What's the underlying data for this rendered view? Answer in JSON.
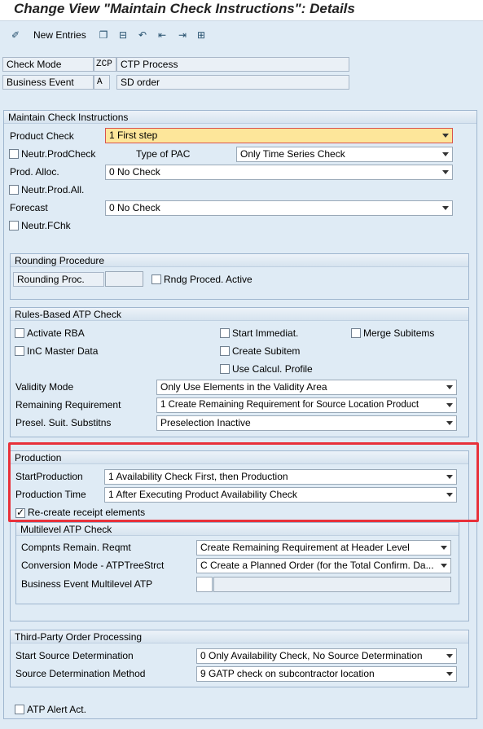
{
  "title": "Change View \"Maintain Check Instructions\": Details",
  "toolbar": {
    "new_entries": "New Entries"
  },
  "header": {
    "check_mode_label": "Check Mode",
    "check_mode_code": "ZCP",
    "check_mode_desc": "CTP Process",
    "business_event_label": "Business Event",
    "business_event_code": "A",
    "business_event_desc": "SD order"
  },
  "maintain": {
    "title": "Maintain Check Instructions",
    "product_check_label": "Product Check",
    "product_check_value": "1 First step",
    "neutr_prodcheck": "Neutr.ProdCheck",
    "type_of_pac_label": "Type of PAC",
    "type_of_pac_value": "Only Time Series Check",
    "prod_alloc_label": "Prod. Alloc.",
    "prod_alloc_value": "0 No Check",
    "neutr_prod_all": "Neutr.Prod.All.",
    "forecast_label": "Forecast",
    "forecast_value": "0 No Check",
    "neutr_fchk": "Neutr.FChk"
  },
  "rounding": {
    "title": "Rounding Procedure",
    "proc_label": "Rounding Proc.",
    "active_label": "Rndg Proced. Active"
  },
  "rba": {
    "title": "Rules-Based ATP Check",
    "activate_rba": "Activate RBA",
    "start_immediat": "Start Immediat.",
    "merge_subitems": "Merge Subitems",
    "inc_master": "InC Master Data",
    "create_subitem": "Create Subitem",
    "use_calcul": "Use Calcul. Profile",
    "validity_label": "Validity Mode",
    "validity_value": "Only Use Elements in the Validity Area",
    "remaining_label": "Remaining Requirement",
    "remaining_value": "1 Create Remaining Requirement for Source Location Product",
    "presel_label": "Presel. Suit. Substitns",
    "presel_value": "Preselection Inactive"
  },
  "production": {
    "title": "Production",
    "start_label": "StartProduction",
    "start_value": "1 Availability Check First, then Production",
    "time_label": "Production Time",
    "time_value": "1 After Executing Product Availability Check",
    "recreate_label": "Re-create receipt elements",
    "multilevel": {
      "title": "Multilevel ATP Check",
      "compnts_label": "Compnts Remain. Reqmt",
      "compnts_value": "Create Remaining Requirement at Header Level",
      "conv_label": "Conversion Mode - ATPTreeStrct",
      "conv_value": "C Create a Planned Order (for the Total Confirm. Da...",
      "bizevent_label": "Business Event Multilevel ATP"
    }
  },
  "third_party": {
    "title": "Third-Party Order Processing",
    "start_label": "Start Source Determination",
    "start_value": "0 Only Availability Check, No Source Determination",
    "method_label": "Source Determination Method",
    "method_value": "9 GATP check on subcontractor location"
  },
  "atp_alert": "ATP Alert Act."
}
